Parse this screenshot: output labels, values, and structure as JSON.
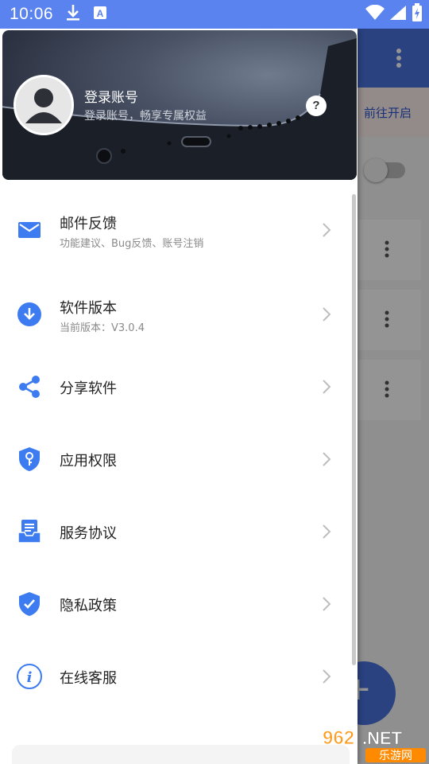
{
  "status_bar": {
    "time": "10:06",
    "icons": [
      "download-icon",
      "keyboard-a-icon",
      "wifi-icon",
      "signal-icon",
      "battery-charging-icon"
    ]
  },
  "background_app": {
    "banner_link": "前往开启",
    "fab_label": "+"
  },
  "drawer": {
    "header": {
      "title": "登录账号",
      "subtitle": "登录账号，畅享专属权益",
      "help_label": "?"
    },
    "items": [
      {
        "title": "邮件反馈",
        "subtitle": "功能建议、Bug反馈、账号注销",
        "icon": "mail-icon"
      },
      {
        "title": "软件版本",
        "subtitle": "当前版本：V3.0.4",
        "icon": "download-circle-icon"
      },
      {
        "title": "分享软件",
        "subtitle": "",
        "icon": "share-icon"
      },
      {
        "title": "应用权限",
        "subtitle": "",
        "icon": "shield-key-icon"
      },
      {
        "title": "服务协议",
        "subtitle": "",
        "icon": "document-inbox-icon"
      },
      {
        "title": "隐私政策",
        "subtitle": "",
        "icon": "shield-check-icon"
      },
      {
        "title": "在线客服",
        "subtitle": "",
        "icon": "info-icon"
      }
    ]
  },
  "watermark": {
    "brand": "962.NET",
    "tagline": "乐游网"
  },
  "colors": {
    "status_bar": "#5a83f0",
    "accent_blue": "#3d7bf0",
    "toolbar": "#4a73de"
  }
}
